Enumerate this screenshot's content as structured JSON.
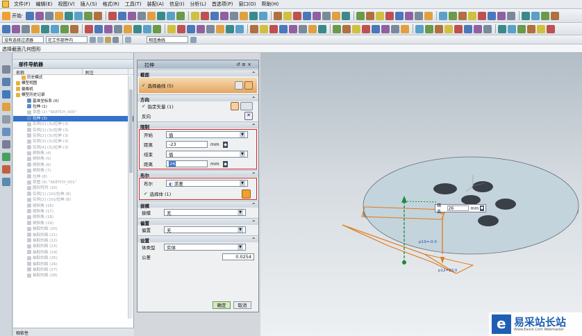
{
  "menu": [
    "文件(F)",
    "编辑(E)",
    "视图(V)",
    "插入(S)",
    "格式(R)",
    "工具(T)",
    "装配(A)",
    "信息(I)",
    "分析(L)",
    "首选项(P)",
    "窗口(O)",
    "帮助(H)"
  ],
  "toolbar": {
    "start_label": "开始·"
  },
  "filter_bar": {
    "filter_label": "没有选择过滤器",
    "assembly_label": "在工作部件内",
    "curve_rule": "相连曲线"
  },
  "status": {
    "prompt": "选择截面几何图形"
  },
  "navigator": {
    "title": "部件导航器",
    "col_name": "名称",
    "col_note": "附注",
    "footer": "相依性",
    "items": [
      {
        "label": "历史模式",
        "state": "normal",
        "indent": 1
      },
      {
        "label": "模型视图",
        "state": "normal",
        "indent": 0
      },
      {
        "label": "摄像机",
        "state": "normal",
        "indent": 0
      },
      {
        "label": "模型历史记录",
        "state": "normal",
        "indent": 0
      },
      {
        "label": "基准坐标系 (0)",
        "state": "normal",
        "indent": 2
      },
      {
        "label": "拉伸 (1)",
        "state": "normal",
        "indent": 2
      },
      {
        "label": "草图 (2) \"SKETCH_000\"",
        "state": "dim",
        "indent": 2
      },
      {
        "label": "拉伸 (3)",
        "state": "sel",
        "indent": 2
      },
      {
        "label": "实例[0] (3)/拉伸 (3)",
        "state": "dim",
        "indent": 2
      },
      {
        "label": "实例[1] (3)/拉伸 (3)",
        "state": "dim",
        "indent": 2
      },
      {
        "label": "实例[2] (3)/拉伸 (3)",
        "state": "dim",
        "indent": 2
      },
      {
        "label": "实例[3] (3)/拉伸 (3)",
        "state": "dim",
        "indent": 2
      },
      {
        "label": "实例[4] (3)/拉伸 (3)",
        "state": "dim",
        "indent": 2
      },
      {
        "label": "倒斜角 (4)",
        "state": "dim",
        "indent": 2
      },
      {
        "label": "倒斜角 (5)",
        "state": "dim",
        "indent": 2
      },
      {
        "label": "倒斜角 (6)",
        "state": "dim",
        "indent": 2
      },
      {
        "label": "倒斜角 (7)",
        "state": "dim",
        "indent": 2
      },
      {
        "label": "拉伸 (8)",
        "state": "dim",
        "indent": 2
      },
      {
        "label": "草图 (9) \"SKETCH_001\"",
        "state": "dim",
        "indent": 2
      },
      {
        "label": "圆形阵列 (10)",
        "state": "dim",
        "indent": 2
      },
      {
        "label": "实例[1] (10)/拉伸 (8)",
        "state": "dim",
        "indent": 2
      },
      {
        "label": "实例[2] (10)/拉伸 (8)",
        "state": "dim",
        "indent": 2
      },
      {
        "label": "倒斜角 (16)",
        "state": "dim",
        "indent": 2
      },
      {
        "label": "倒斜角 (17)",
        "state": "dim",
        "indent": 2
      },
      {
        "label": "倒斜角 (18)",
        "state": "dim",
        "indent": 2
      },
      {
        "label": "倒斜角 (19)",
        "state": "dim",
        "indent": 2
      },
      {
        "label": "抽取的面 (20)",
        "state": "dim",
        "indent": 2
      },
      {
        "label": "抽取的面 (21)",
        "state": "dim",
        "indent": 2
      },
      {
        "label": "抽取的面 (22)",
        "state": "dim",
        "indent": 2
      },
      {
        "label": "抽取的面 (23)",
        "state": "dim",
        "indent": 2
      },
      {
        "label": "抽取的面 (24)",
        "state": "dim",
        "indent": 2
      },
      {
        "label": "抽取的面 (25)",
        "state": "dim",
        "indent": 2
      },
      {
        "label": "抽取的面 (26)",
        "state": "dim",
        "indent": 2
      },
      {
        "label": "抽取的面 (27)",
        "state": "dim",
        "indent": 2
      },
      {
        "label": "抽取的面 (28)",
        "state": "dim",
        "indent": 2
      }
    ]
  },
  "dialog": {
    "title": "拉伸",
    "sections": {
      "section": "截面",
      "direction": "方向",
      "limits": "限制",
      "boolean": "布尔",
      "draft": "拔模",
      "offset": "偏置",
      "settings": "设置"
    },
    "select_curve": "选择曲线 (5)",
    "specify_vector": "指定矢量 (1)",
    "reverse": "反向",
    "start_label": "开始",
    "start_value": "值",
    "distance_label": "距离",
    "start_distance": "-23",
    "unit": "mm",
    "end_label": "结束",
    "end_value": "值",
    "end_distance": "26",
    "boolean_label": "布尔",
    "boolean_value": "求差",
    "select_body": "选择体 (1)",
    "draft_label": "拔模",
    "draft_value": "无",
    "offset_label": "偏置",
    "offset_value": "无",
    "body_type_label": "体类型",
    "body_type_value": "实体",
    "tolerance_label": "公差",
    "tolerance_value": "0.0254",
    "ok": "确定",
    "cancel": "取消"
  },
  "viewport": {
    "end_label": "结束",
    "end_value": "26",
    "unit": "mm",
    "tag1": "p13=-0.0",
    "tag2": "p12=23.0"
  },
  "watermark": {
    "text": "易采站长站",
    "sub": "Www.Easck.Com Webmaster"
  }
}
